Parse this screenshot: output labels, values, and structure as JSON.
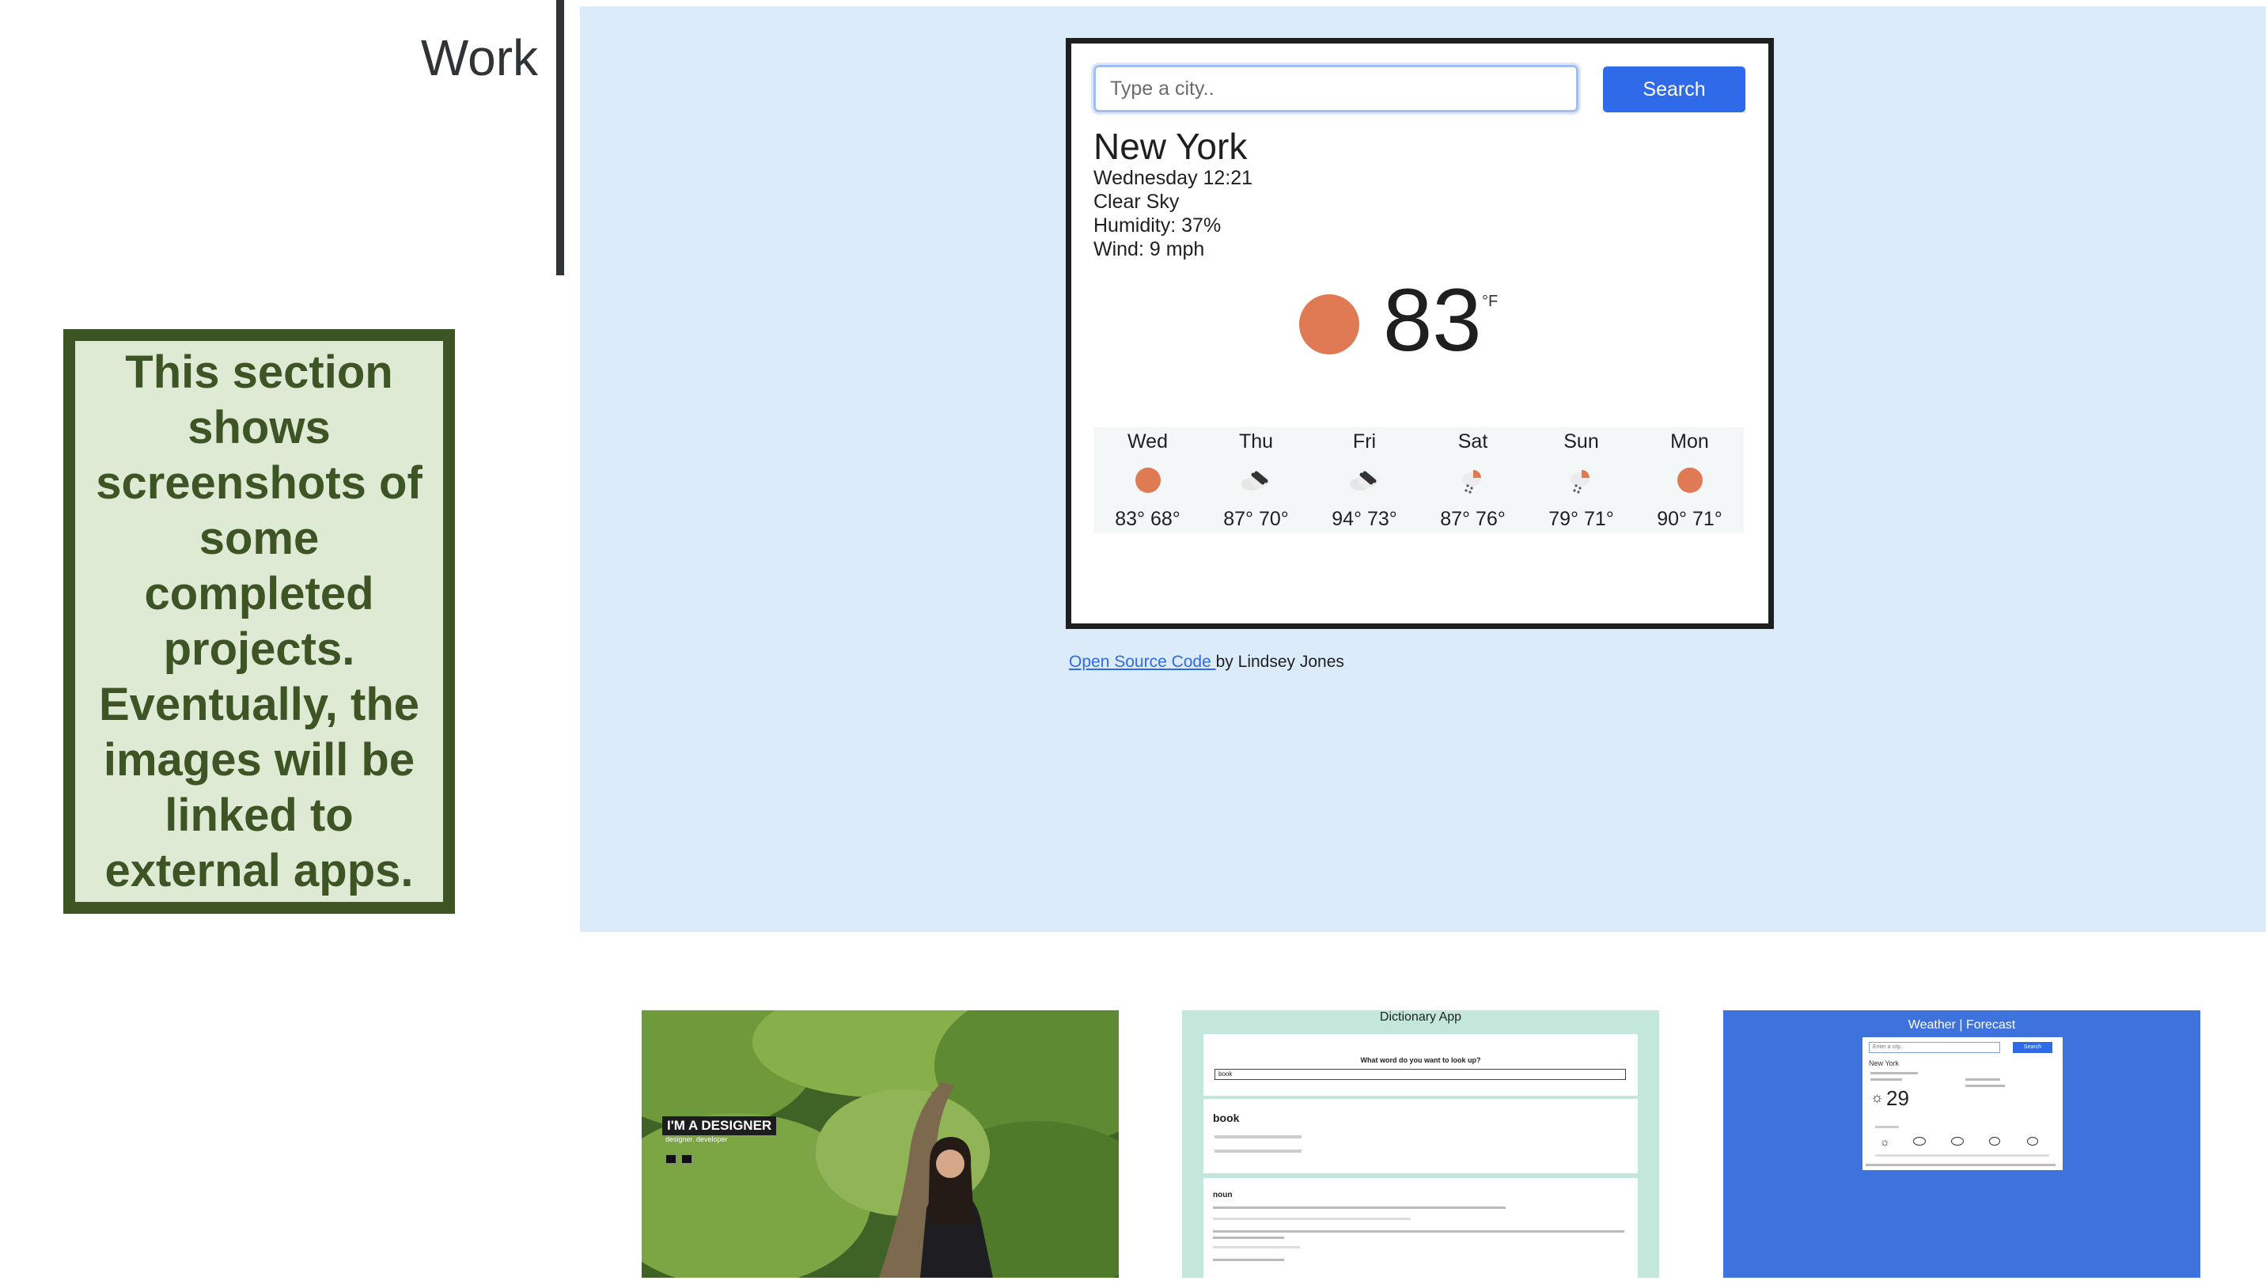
{
  "sidebar": {
    "heading": "Work",
    "note": "This section shows screenshots of some completed projects. Eventually, the images will be linked to external apps."
  },
  "weather_app": {
    "search_placeholder": "Type a city..",
    "search_label": "Search",
    "city": "New York",
    "datetime": "Wednesday 12:21",
    "description": "Clear Sky",
    "humidity": "Humidity: 37%",
    "wind": "Wind: 9 mph",
    "temperature": "83",
    "unit": "°F",
    "forecast": [
      {
        "day": "Wed",
        "icon": "sun-icon",
        "temps": "83° 68°"
      },
      {
        "day": "Thu",
        "icon": "cloud-icon",
        "temps": "87° 70°"
      },
      {
        "day": "Fri",
        "icon": "cloud-icon",
        "temps": "94° 73°"
      },
      {
        "day": "Sat",
        "icon": "sun-rain-icon",
        "temps": "87° 76°"
      },
      {
        "day": "Sun",
        "icon": "sun-rain-icon",
        "temps": "79° 71°"
      },
      {
        "day": "Mon",
        "icon": "sun-icon",
        "temps": "90° 71°"
      }
    ],
    "credit_link": "Open Source Code ",
    "credit_text": "by Lindsey Jones",
    "accent_color": "#2f6be8",
    "sun_color": "#e07a55"
  },
  "thumbnails": {
    "portfolio": {
      "headline": "I'M A DESIGNER",
      "subline": "designer. developer"
    },
    "dictionary": {
      "title": "Dictionary App",
      "question": "What word do you want to look up?",
      "input_value": "book",
      "word": "book",
      "part_of_speech": "noun"
    },
    "weather": {
      "title": "Weather | Forecast",
      "placeholder": "Enter a city..",
      "button": "Search",
      "city": "New York",
      "temperature": "29"
    }
  }
}
